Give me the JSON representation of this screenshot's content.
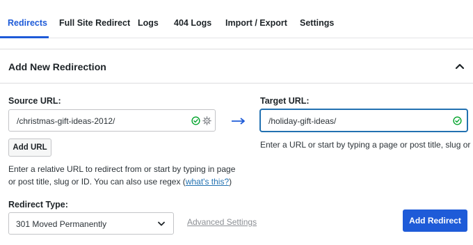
{
  "tabs": [
    {
      "label": "Redirects",
      "active": true
    },
    {
      "label": "Full Site Redirect"
    },
    {
      "label": "Logs"
    },
    {
      "label": "404 Logs"
    },
    {
      "label": "Import / Export"
    },
    {
      "label": "Settings"
    }
  ],
  "panel": {
    "title": "Add New Redirection",
    "collapse_icon": "chevron-up-icon"
  },
  "source": {
    "label": "Source URL:",
    "value": "/christmas-gift-ideas-2012/",
    "valid_icon": "check-circle-icon",
    "settings_icon": "gear-icon",
    "add_url_label": "Add URL",
    "help_line1": "Enter a relative URL to redirect from or start by typing in page",
    "help_line2_prefix": "or post title, slug or ID. You can also use regex (",
    "help_link": "what's this?",
    "help_line2_suffix": ")"
  },
  "arrow_icon": "arrow-right-icon",
  "target": {
    "label": "Target URL:",
    "value": "/holiday-gift-ideas/",
    "valid_icon": "check-circle-icon",
    "help": "Enter a URL or start by typing a page or post title, slug or ID."
  },
  "redirect_type": {
    "label": "Redirect Type:",
    "selected": "301 Moved Permanently"
  },
  "advanced_link": "Advanced Settings",
  "submit_label": "Add Redirect",
  "colors": {
    "accent": "#1e5bd8",
    "success": "#00a32a",
    "focus_border": "#2271b1"
  }
}
